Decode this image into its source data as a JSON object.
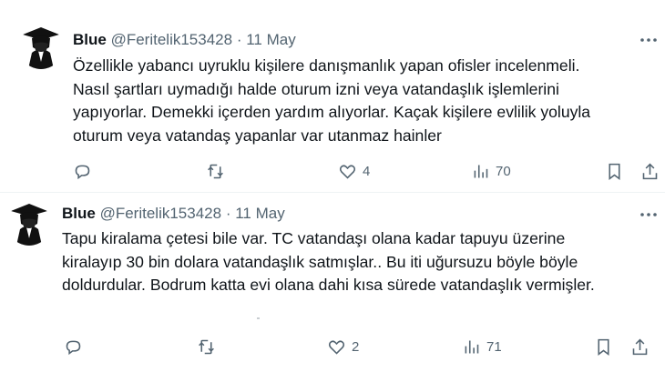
{
  "tweets": [
    {
      "name": "Blue",
      "handle": "@Feritelik153428",
      "separator": "·",
      "date": "11 May",
      "lines": [
        "Özellikle yabancı uyruklu kişilere danışmanlık yapan ofisler incelenmeli.",
        "Nasıl şartları uymadığı halde oturum izni veya vatandaşlık işlemlerini",
        "yapıyorlar. Demekki içerden yardım alıyorlar. Kaçak kişilere evlilik yoluyla",
        "oturum veya vatandaş yapanlar var utanmaz hainler"
      ],
      "likes": "4",
      "views": "70"
    },
    {
      "name": "Blue",
      "handle": "@Feritelik153428",
      "separator": "·",
      "date": "11 May",
      "lines": [
        "Tapu kiralama çetesi bile var. TC vatandaşı olana kadar tapuyu üzerine",
        "kiralayıp 30 bin dolara vatandaşlık satmışlar.. Bu iti uğursuzu böyle böyle",
        "doldurdular. Bodrum katta evi olana dahi kısa sürede vatandaşlık vermişler."
      ],
      "likes": "2",
      "views": "71"
    }
  ],
  "icons": {
    "more": "more-icon",
    "reply": "reply-icon",
    "retweet": "retweet-icon",
    "like": "like-icon",
    "views": "views-icon",
    "bookmark": "bookmark-icon",
    "share": "share-icon"
  },
  "colors": {
    "text": "#0f1419",
    "secondary": "#536471",
    "divider": "#eff3f4"
  }
}
